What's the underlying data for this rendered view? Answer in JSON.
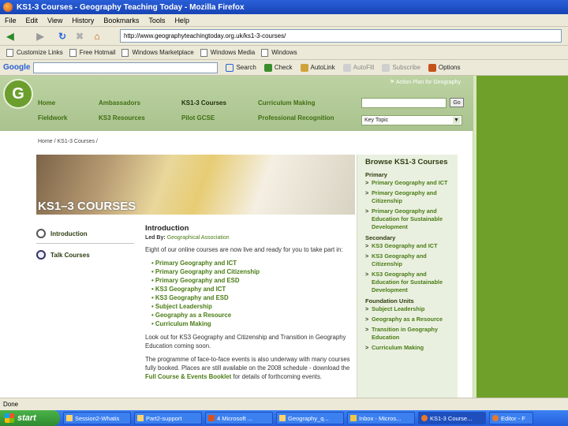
{
  "window": {
    "title": "KS1-3 Courses - Geography Teaching Today - Mozilla Firefox"
  },
  "menu": [
    "File",
    "Edit",
    "View",
    "History",
    "Bookmarks",
    "Tools",
    "Help"
  ],
  "navbar": {
    "url": "http://www.geographyteachingtoday.org.uk/ks1-3-courses/"
  },
  "links_bar": [
    "Customize Links",
    "Free Hotmail",
    "Windows Marketplace",
    "Windows Media",
    "Windows"
  ],
  "google_bar": {
    "logo": "Google",
    "items": [
      "Search",
      "Check",
      "AutoLink",
      "AutoFill",
      "Subscribe",
      "Options"
    ]
  },
  "site": {
    "logo_letter": "G",
    "action_plan": "Action Plan for Geography",
    "nav": {
      "col1": [
        "Home",
        "Fieldwork"
      ],
      "col2": [
        "Ambassadors",
        "KS3 Resources"
      ],
      "col3": [
        "KS1-3 Courses",
        "Pilot GCSE"
      ],
      "col4": [
        "Curriculum Making",
        "Professional Recognition"
      ]
    },
    "go_label": "Go",
    "key_topic": "Key Topic",
    "breadcrumb": "Home / KS1-3 Courses /",
    "banner_title": "KS1–3 COURSES",
    "left_nav": [
      "Introduction",
      "Talk Courses"
    ],
    "intro": {
      "heading": "Introduction",
      "led_by_label": "Led By:",
      "led_by": "Geographical Association",
      "p1": "Eight of our online courses are now live and ready for you to take part in:",
      "courses": [
        "Primary Geography and ICT",
        "Primary Geography and Citizenship",
        "Primary Geography and ESD",
        "KS3 Geography and ICT",
        "KS3 Geography and ESD",
        "Subject Leadership",
        "Geography as a Resource",
        "Curriculum Making"
      ],
      "p2": "Look out for KS3 Geography and Citizenship and Transition in Geography Education coming soon.",
      "p3_start": "The programme of face-to-face events is also underway with many courses fully booked. Places are still available on the 2008 schedule - download the",
      "p3_link": "Full Course & Events Booklet",
      "p3_end": "for details of forthcoming events."
    },
    "browse": {
      "title": "Browse KS1-3 Courses",
      "sections": [
        {
          "heading": "Primary",
          "items": [
            "Primary Geography and ICT",
            "Primary Geography and Citizenship",
            "Primary Geography and Education for Sustainable Development"
          ]
        },
        {
          "heading": "Secondary",
          "items": [
            "KS3 Geography and ICT",
            "KS3 Geography and Citizenship",
            "KS3 Geography and Education for Sustainable Development"
          ]
        },
        {
          "heading": "Foundation Units",
          "items": [
            "Subject Leadership",
            "Geography as a Resource",
            "Transition in Geography Education",
            "Curriculum Making"
          ]
        }
      ]
    }
  },
  "status": "Done",
  "taskbar": {
    "start": "start",
    "tasks": [
      "Session2-Whatis",
      "Part2-support",
      "4 Microsoft ...",
      "Geography_q...",
      "Inbox - Micros...",
      "KS1-3 Course...",
      "Editor - F"
    ]
  }
}
